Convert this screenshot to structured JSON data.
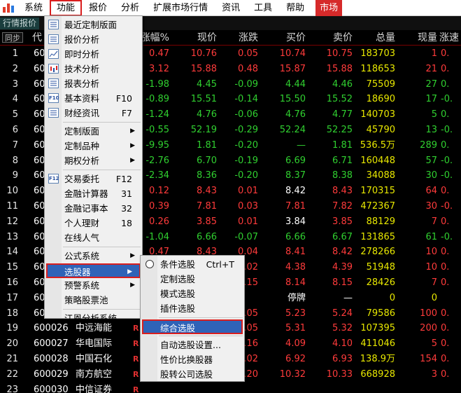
{
  "menubar": {
    "items": [
      "系统",
      "功能",
      "报价",
      "分析",
      "扩展市场行情",
      "资讯",
      "工具",
      "帮助"
    ],
    "market_label": "市场"
  },
  "tabs": {
    "quote_tab": "行情报价"
  },
  "grid": {
    "sync_label": "同步",
    "headers": {
      "code": "代",
      "change_pct": "涨幅%",
      "price": "现价",
      "change": "涨跌",
      "bid": "买价",
      "ask": "卖价",
      "volume": "总量",
      "current": "现量",
      "speed": "涨速"
    },
    "rows": [
      {
        "idx": "1",
        "code": "60",
        "name": "",
        "flag": "",
        "pct": "0.47",
        "price": "10.76",
        "chg": "0.05",
        "bid": "10.74",
        "ask": "10.75",
        "vol": "183703",
        "cur": "1",
        "spd": "0.",
        "dir": "up"
      },
      {
        "idx": "2",
        "code": "60",
        "name": "",
        "flag": "",
        "pct": "3.12",
        "price": "15.88",
        "chg": "0.48",
        "bid": "15.87",
        "ask": "15.88",
        "vol": "118653",
        "cur": "21",
        "spd": "0.",
        "dir": "up"
      },
      {
        "idx": "3",
        "code": "60",
        "name": "",
        "flag": "",
        "pct": "-1.98",
        "price": "4.45",
        "chg": "-0.09",
        "bid": "4.44",
        "ask": "4.46",
        "vol": "75509",
        "cur": "27",
        "spd": "0.",
        "dir": "down"
      },
      {
        "idx": "4",
        "code": "60",
        "name": "",
        "flag": "",
        "pct": "-0.89",
        "price": "15.51",
        "chg": "-0.14",
        "bid": "15.50",
        "ask": "15.52",
        "vol": "18690",
        "cur": "17",
        "spd": "-0.",
        "dir": "down"
      },
      {
        "idx": "5",
        "code": "60",
        "name": "",
        "flag": "",
        "pct": "-1.24",
        "price": "4.76",
        "chg": "-0.06",
        "bid": "4.76",
        "ask": "4.77",
        "vol": "140703",
        "cur": "5",
        "spd": "0.",
        "dir": "down"
      },
      {
        "idx": "6",
        "code": "60",
        "name": "",
        "flag": "",
        "pct": "-0.55",
        "price": "52.19",
        "chg": "-0.29",
        "bid": "52.24",
        "ask": "52.25",
        "vol": "45790",
        "cur": "13",
        "spd": "-0.",
        "dir": "down"
      },
      {
        "idx": "7",
        "code": "60",
        "name": "",
        "flag": "",
        "pct": "-9.95",
        "price": "1.81",
        "chg": "-0.20",
        "bid": "—",
        "ask": "1.81",
        "vol": "536.5万",
        "cur": "289",
        "spd": "0.",
        "dir": "down"
      },
      {
        "idx": "8",
        "code": "60",
        "name": "",
        "flag": "",
        "pct": "-2.76",
        "price": "6.70",
        "chg": "-0.19",
        "bid": "6.69",
        "ask": "6.71",
        "vol": "160448",
        "cur": "57",
        "spd": "-0.",
        "dir": "down"
      },
      {
        "idx": "9",
        "code": "60",
        "name": "",
        "flag": "",
        "pct": "-2.34",
        "price": "8.36",
        "chg": "-0.20",
        "bid": "8.37",
        "ask": "8.38",
        "vol": "34088",
        "cur": "30",
        "spd": "-0.",
        "dir": "down"
      },
      {
        "idx": "10",
        "code": "60",
        "name": "",
        "flag": "",
        "pct": "0.12",
        "price": "8.43",
        "chg": "0.01",
        "bid": "8.42",
        "ask": "8.43",
        "vol": "170315",
        "cur": "64",
        "spd": "0.",
        "dir": "up"
      },
      {
        "idx": "11",
        "code": "60",
        "name": "",
        "flag": "",
        "pct": "0.39",
        "price": "7.81",
        "chg": "0.03",
        "bid": "7.81",
        "ask": "7.82",
        "vol": "472367",
        "cur": "30",
        "spd": "-0.",
        "dir": "up"
      },
      {
        "idx": "12",
        "code": "60",
        "name": "",
        "flag": "",
        "pct": "0.26",
        "price": "3.85",
        "chg": "0.01",
        "bid": "3.84",
        "ask": "3.85",
        "vol": "88129",
        "cur": "7",
        "spd": "0.",
        "dir": "up"
      },
      {
        "idx": "13",
        "code": "60",
        "name": "",
        "flag": "",
        "pct": "-1.04",
        "price": "6.66",
        "chg": "-0.07",
        "bid": "6.66",
        "ask": "6.67",
        "vol": "131865",
        "cur": "61",
        "spd": "-0.",
        "dir": "down"
      },
      {
        "idx": "14",
        "code": "60",
        "name": "",
        "flag": "",
        "pct": "0.47",
        "price": "8.43",
        "chg": "0.04",
        "bid": "8.41",
        "ask": "8.42",
        "vol": "278266",
        "cur": "10",
        "spd": "0.",
        "dir": "up"
      },
      {
        "idx": "15",
        "code": "60",
        "name": "",
        "flag": "",
        "pct": "",
        "price": "",
        "chg": "0.02",
        "bid": "4.38",
        "ask": "4.39",
        "vol": "51948",
        "cur": "10",
        "spd": "0.",
        "dir": "up"
      },
      {
        "idx": "16",
        "code": "60",
        "name": "",
        "flag": "",
        "pct": "",
        "price": "",
        "chg": "0.15",
        "bid": "8.14",
        "ask": "8.15",
        "vol": "28426",
        "cur": "7",
        "spd": "0.",
        "dir": "up"
      },
      {
        "idx": "17",
        "code": "60",
        "name": "",
        "flag": "",
        "pct": "",
        "price": "",
        "chg": "",
        "bid": "停牌",
        "ask": "—",
        "vol": "0",
        "cur": "0",
        "spd": "",
        "dir": "flat"
      },
      {
        "idx": "18",
        "code": "60",
        "name": "",
        "flag": "",
        "pct": "",
        "price": "",
        "chg": "0.05",
        "bid": "5.23",
        "ask": "5.24",
        "vol": "79586",
        "cur": "100",
        "spd": "0.",
        "dir": "up"
      },
      {
        "idx": "19",
        "code": "600026",
        "name": "中远海能",
        "flag": "R",
        "pct": "",
        "price": "",
        "chg": "0.05",
        "bid": "5.31",
        "ask": "5.32",
        "vol": "107395",
        "cur": "200",
        "spd": "0.",
        "dir": "up"
      },
      {
        "idx": "20",
        "code": "600027",
        "name": "华电国际",
        "flag": "R",
        "pct": "",
        "price": "",
        "chg": "0.16",
        "bid": "4.09",
        "ask": "4.10",
        "vol": "411046",
        "cur": "5",
        "spd": "0.",
        "dir": "up"
      },
      {
        "idx": "21",
        "code": "600028",
        "name": "中国石化",
        "flag": "R",
        "pct": "",
        "price": "",
        "chg": "0.02",
        "bid": "6.92",
        "ask": "6.93",
        "vol": "138.9万",
        "cur": "154",
        "spd": "0.",
        "dir": "up"
      },
      {
        "idx": "22",
        "code": "600029",
        "name": "南方航空",
        "flag": "R",
        "pct": "",
        "price": "",
        "chg": "0.20",
        "bid": "10.32",
        "ask": "10.33",
        "vol": "668928",
        "cur": "3",
        "spd": "0.",
        "dir": "up"
      },
      {
        "idx": "23",
        "code": "600030",
        "name": "中信证券",
        "flag": "R",
        "pct": "",
        "price": "",
        "chg": "",
        "bid": "",
        "ask": "",
        "vol": "",
        "cur": "",
        "spd": "",
        "dir": "up"
      }
    ]
  },
  "function_menu": {
    "items": [
      {
        "label": "最近定制版面",
        "shortcut": "",
        "arrow": false,
        "icon": "recent-layout-icon"
      },
      {
        "label": "报价分析",
        "shortcut": "",
        "arrow": false,
        "icon": "quote-grid-icon"
      },
      {
        "label": "即时分析",
        "shortcut": "",
        "arrow": false,
        "icon": "line-chart-icon"
      },
      {
        "label": "技术分析",
        "shortcut": "",
        "arrow": false,
        "icon": "candlestick-icon"
      },
      {
        "label": "报表分析",
        "shortcut": "",
        "arrow": false,
        "icon": "report-icon"
      },
      {
        "label": "基本资料",
        "shortcut": "F10",
        "arrow": false,
        "icon": "f10-icon"
      },
      {
        "label": "财经资讯",
        "shortcut": "F7",
        "arrow": false,
        "icon": "news-icon"
      },
      {
        "label": "定制版面",
        "shortcut": "",
        "arrow": true,
        "icon": ""
      },
      {
        "label": "定制品种",
        "shortcut": "",
        "arrow": true,
        "icon": ""
      },
      {
        "label": "期权分析",
        "shortcut": "",
        "arrow": true,
        "icon": ""
      },
      {
        "label": "交易委托",
        "shortcut": "F12",
        "arrow": false,
        "icon": "f12-icon"
      },
      {
        "label": "金融计算器",
        "shortcut": "31",
        "arrow": false,
        "icon": ""
      },
      {
        "label": "金融记事本",
        "shortcut": "32",
        "arrow": false,
        "icon": ""
      },
      {
        "label": "个人理财",
        "shortcut": "18",
        "arrow": false,
        "icon": ""
      },
      {
        "label": "在线人气",
        "shortcut": "",
        "arrow": false,
        "icon": ""
      },
      {
        "label": "公式系统",
        "shortcut": "",
        "arrow": true,
        "icon": ""
      },
      {
        "label": "选股器",
        "shortcut": "",
        "arrow": true,
        "icon": ""
      },
      {
        "label": "预警系统",
        "shortcut": "",
        "arrow": true,
        "icon": ""
      },
      {
        "label": "策略股票池",
        "shortcut": "",
        "arrow": false,
        "icon": ""
      },
      {
        "label": "江恩分析系统",
        "shortcut": "",
        "arrow": false,
        "icon": ""
      }
    ],
    "icon_text": {
      "f10": "F10",
      "f12": "F12"
    }
  },
  "selector_menu": {
    "items": [
      {
        "label": "条件选股",
        "shortcut": "Ctrl+T"
      },
      {
        "label": "定制选股",
        "shortcut": ""
      },
      {
        "label": "模式选股",
        "shortcut": ""
      },
      {
        "label": "插件选股",
        "shortcut": ""
      },
      {
        "label": "综合选股",
        "shortcut": ""
      },
      {
        "label": "自动选股设置...",
        "shortcut": ""
      },
      {
        "label": "性价比换股器",
        "shortcut": ""
      },
      {
        "label": "股转公司选股",
        "shortcut": ""
      }
    ]
  }
}
